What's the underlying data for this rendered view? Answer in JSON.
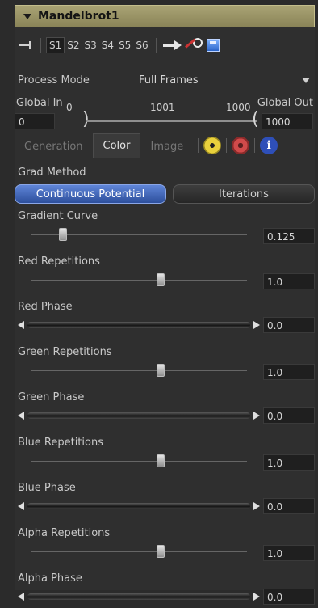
{
  "node": {
    "name": "Mandelbrot1"
  },
  "toolbar": {
    "slots": [
      "S1",
      "S2",
      "S3",
      "S4",
      "S5",
      "S6"
    ],
    "active_slot": "S1"
  },
  "process_mode": {
    "label": "Process Mode",
    "value": "Full Frames"
  },
  "global_range": {
    "in_label": "Global In",
    "out_label": "Global Out",
    "in_value": "0",
    "out_value": "1000",
    "ticks": [
      "0",
      "1001",
      "1000"
    ]
  },
  "tabs": [
    {
      "label": "Generation",
      "active": false
    },
    {
      "label": "Color",
      "active": true
    },
    {
      "label": "Image",
      "active": false
    }
  ],
  "tab_icons": [
    "radioactive-icon",
    "gear-icon",
    "info-icon"
  ],
  "grad_method": {
    "label": "Grad Method",
    "options": [
      "Continuous Potential",
      "Iterations"
    ],
    "selected": "Continuous Potential"
  },
  "controls": [
    {
      "id": "gradient-curve",
      "label": "Gradient Curve",
      "kind": "slider",
      "value": "0.125",
      "level": 0.15
    },
    {
      "id": "red-repetitions",
      "label": "Red Repetitions",
      "kind": "slider",
      "value": "1.0",
      "level": 0.6
    },
    {
      "id": "red-phase",
      "label": "Red Phase",
      "kind": "phase",
      "value": "0.0"
    },
    {
      "id": "green-repetitions",
      "label": "Green Repetitions",
      "kind": "slider",
      "value": "1.0",
      "level": 0.6
    },
    {
      "id": "green-phase",
      "label": "Green Phase",
      "kind": "phase",
      "value": "0.0"
    },
    {
      "id": "blue-repetitions",
      "label": "Blue Repetitions",
      "kind": "slider",
      "value": "1.0",
      "level": 0.6
    },
    {
      "id": "blue-phase",
      "label": "Blue Phase",
      "kind": "phase",
      "value": "0.0"
    },
    {
      "id": "alpha-repetitions",
      "label": "Alpha Repetitions",
      "kind": "slider",
      "value": "1.0",
      "level": 0.6
    },
    {
      "id": "alpha-phase",
      "label": "Alpha Phase",
      "kind": "phase",
      "value": "0.0"
    }
  ],
  "colors": {
    "header": "#9e9866",
    "selected_button": "#4a6fc4",
    "panel_bg": "#2f2f2f"
  }
}
